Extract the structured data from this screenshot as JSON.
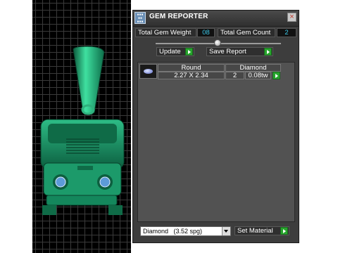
{
  "window": {
    "title": "GEM REPORTER",
    "icon": "app-icon",
    "close_icon": "close-icon"
  },
  "stats": {
    "weight_label": "Total Gem Weight",
    "weight_value": "08",
    "count_label": "Total Gem Count",
    "count_value": "2"
  },
  "actions": {
    "update_label": "Update",
    "save_report_label": "Save Report"
  },
  "gem_table": {
    "thumbnail": "round-gem-thumbnail",
    "headers": [
      "Round",
      "Diamond"
    ],
    "row": {
      "size": "2.27 X 2.34",
      "count": "2",
      "weight": "0.08tw"
    }
  },
  "material": {
    "selected": "Diamond   (3.52 spg)",
    "button_label": "Set Material"
  },
  "colors": {
    "accent_green": "#27a52d",
    "value_cyan": "#3cc8e8",
    "panel_bg": "#3d3d3d",
    "model_green": "#1fa071"
  }
}
